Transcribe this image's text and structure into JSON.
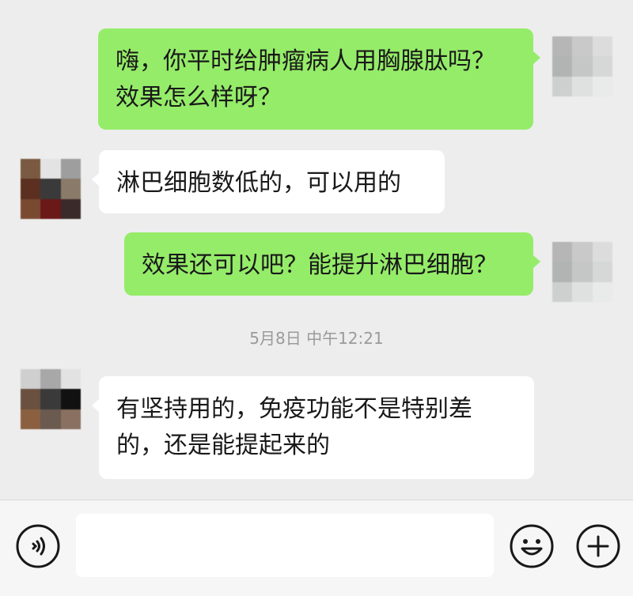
{
  "conversation": {
    "messages": [
      {
        "sender": "me",
        "lines": [
          "嗨，你平时给肿瘤病人用胸腺肽吗？",
          "效果怎么样呀？"
        ]
      },
      {
        "sender": "other",
        "lines": [
          "淋巴细胞数低的，可以用的"
        ]
      },
      {
        "sender": "me",
        "lines": [
          "效果还可以吧？能提升淋巴细胞？"
        ]
      },
      {
        "sender": "other",
        "lines": [
          "有坚持用的，免疫功能不是特别差",
          "的，还是能提起来的"
        ]
      }
    ],
    "timestamp": "5月8日 中午12:21"
  },
  "avatars": {
    "me_colors": [
      "#b6b6b6",
      "#c9c9c9",
      "#dcdcdc",
      "#b0b4b2",
      "#c4c7c5",
      "#d6d8d7",
      "#cdd0ce",
      "#dfe1e0",
      "#e9eaea"
    ],
    "other1_colors": [
      "#7a5a40",
      "#e3e3e3",
      "#9e9e9e",
      "#5b3020",
      "#3a3a3a",
      "#8a7a6a",
      "#7a4a30",
      "#6a1818",
      "#3a2a2a"
    ],
    "other2_colors": [
      "#cfcfcf",
      "#a8a8a8",
      "#e2e2e2",
      "#6a5040",
      "#3a3a3a",
      "#111111",
      "#8a6040",
      "#6a5a50",
      "#8a7060"
    ]
  },
  "input_bar": {
    "input_value": "",
    "voice_icon": "voice-icon",
    "emoji_icon": "emoji-icon",
    "add_icon": "plus-icon"
  }
}
